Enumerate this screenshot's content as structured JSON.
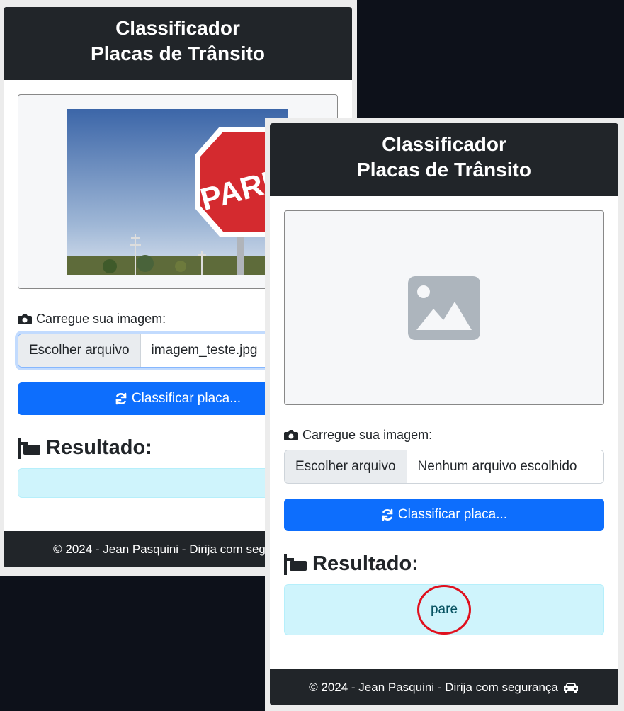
{
  "header": {
    "line1": "Classificador",
    "line2": "Placas de Trânsito"
  },
  "upload_label": "Carregue sua imagem:",
  "file_button": "Escolher arquivo",
  "classify_button": "Classificar placa...",
  "result_title": "Resultado:",
  "footer_text": "© 2024 - Jean Pasquini - Dirija com segurança",
  "window1": {
    "file_name": "imagem_teste.jpg",
    "image_text": "PARE",
    "result": ""
  },
  "window2": {
    "file_name": "Nenhum arquivo escolhido",
    "result": "pare"
  },
  "colors": {
    "primary": "#0d6efd",
    "dark": "#212529",
    "info_bg": "#cff4fc",
    "annotation": "#e0101e",
    "stop_sign": "#d42a2f"
  }
}
